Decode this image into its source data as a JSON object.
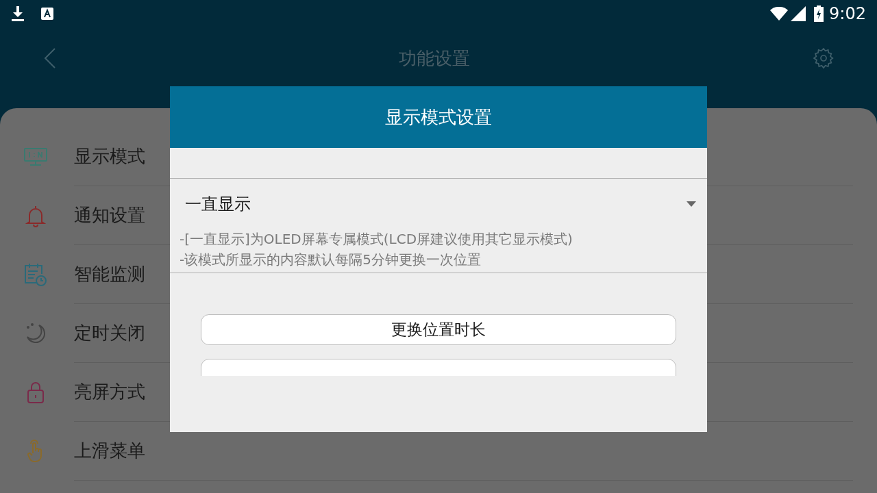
{
  "status_bar": {
    "time": "9:02"
  },
  "header": {
    "title": "功能设置"
  },
  "menu": [
    {
      "label": "显示模式"
    },
    {
      "label": "通知设置"
    },
    {
      "label": "智能监测"
    },
    {
      "label": "定时关闭"
    },
    {
      "label": "亮屏方式"
    },
    {
      "label": "上滑菜单"
    }
  ],
  "dialog": {
    "title": "显示模式设置",
    "dropdown": {
      "value": "一直显示"
    },
    "notes": [
      "-[一直显示]为OLED屏幕专属模式(LCD屏建议使用其它显示模式)",
      "-该模式所显示的内容默认每隔5分钟更换一次位置"
    ],
    "buttons": [
      {
        "label": "更换位置时长"
      }
    ]
  }
}
